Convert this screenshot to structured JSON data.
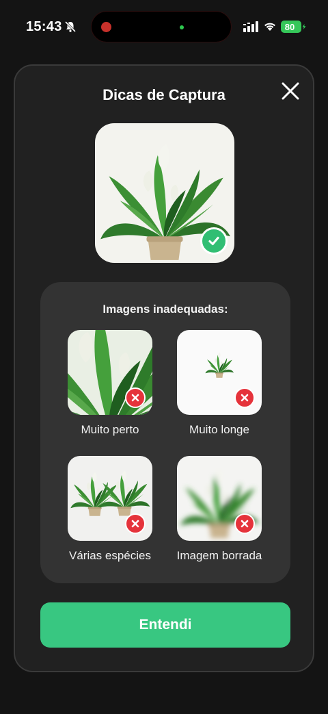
{
  "status_bar": {
    "time": "15:43",
    "battery": "80"
  },
  "modal": {
    "title": "Dicas de Captura",
    "good_image_icon": "checkmark-icon",
    "bad_section": {
      "title": "Imagens inadequadas:",
      "items": [
        {
          "label": "Muito perto"
        },
        {
          "label": "Muito longe"
        },
        {
          "label": "Várias espécies"
        },
        {
          "label": "Imagem borrada"
        }
      ]
    },
    "confirm_label": "Entendi"
  },
  "colors": {
    "background": "#141414",
    "card": "#212121",
    "panel": "#333333",
    "accent": "#38c781",
    "error": "#e5333b",
    "success": "#31be73"
  }
}
